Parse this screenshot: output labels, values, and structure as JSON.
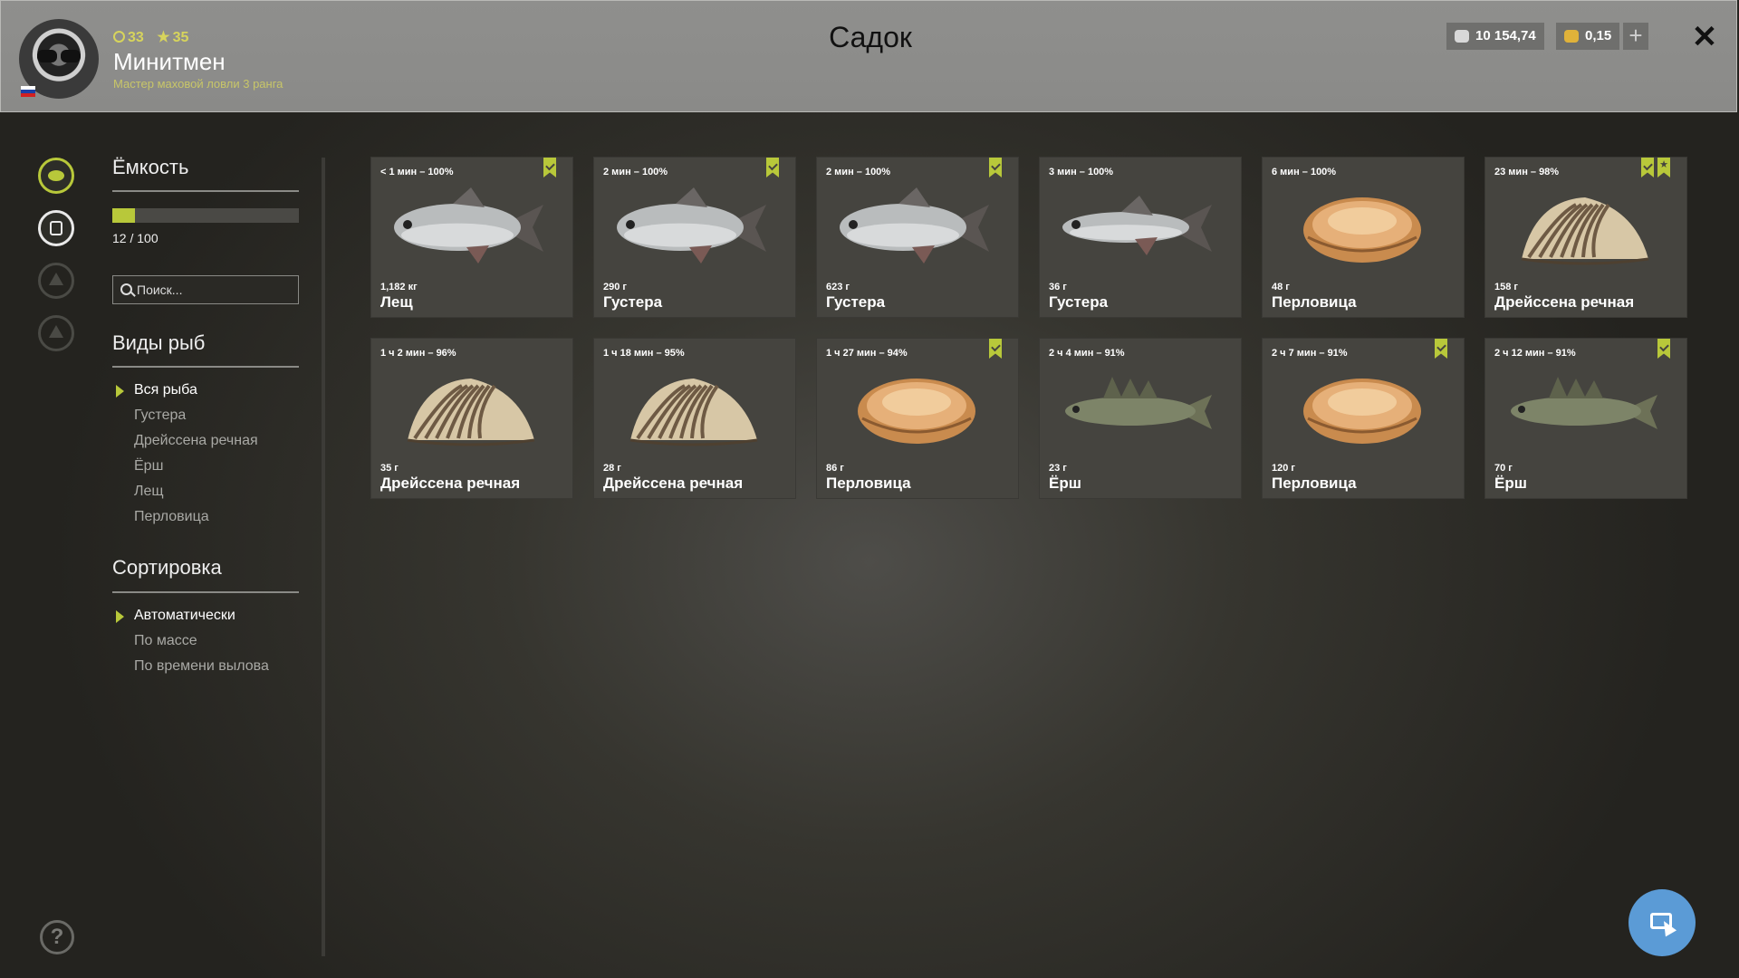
{
  "header": {
    "title": "Садок",
    "player": {
      "name": "Минитмен",
      "rank_title": "Мастер маховой ловли 3 ранга",
      "level": "33",
      "stars": "35",
      "flag_colors": [
        "#ffffff",
        "#1c3fa8",
        "#d22020"
      ]
    },
    "currency": {
      "silver": "10 154,74",
      "gold": "0,15"
    },
    "add_label": "+",
    "close_label": "✕"
  },
  "sidebar_icons": [
    "fish-icon",
    "keepnet-icon",
    "camp-icon",
    "home-icon"
  ],
  "capacity": {
    "title": "Ёмкость",
    "text": "12 / 100",
    "fill_fraction": 0.12
  },
  "search": {
    "placeholder": "Поиск..."
  },
  "species": {
    "title": "Виды рыб",
    "items": [
      {
        "label": "Вся рыба",
        "active": true
      },
      {
        "label": "Густера",
        "active": false
      },
      {
        "label": "Дрейссена речная",
        "active": false
      },
      {
        "label": "Ёрш",
        "active": false
      },
      {
        "label": "Лещ",
        "active": false
      },
      {
        "label": "Перловица",
        "active": false
      }
    ]
  },
  "sorting": {
    "title": "Сортировка",
    "items": [
      {
        "label": "Автоматически",
        "active": true
      },
      {
        "label": "По массе",
        "active": false
      },
      {
        "label": "По времени вылова",
        "active": false
      }
    ]
  },
  "catch": [
    {
      "time": "< 1 мин – 100%",
      "weight": "1,182 кг",
      "name": "Лещ",
      "kind": "bream",
      "marked": true,
      "star": false
    },
    {
      "time": "2 мин – 100%",
      "weight": "290 г",
      "name": "Густера",
      "kind": "bream",
      "marked": true,
      "star": false
    },
    {
      "time": "2 мин – 100%",
      "weight": "623 г",
      "name": "Густера",
      "kind": "bream",
      "marked": true,
      "star": false
    },
    {
      "time": "3 мин – 100%",
      "weight": "36 г",
      "name": "Густера",
      "kind": "slim",
      "marked": false,
      "star": false
    },
    {
      "time": "6 мин – 100%",
      "weight": "48 г",
      "name": "Перловица",
      "kind": "mussel",
      "marked": false,
      "star": false
    },
    {
      "time": "23 мин – 98%",
      "weight": "158 г",
      "name": "Дрейссена речная",
      "kind": "zebra",
      "marked": true,
      "star": true
    },
    {
      "time": "1 ч 2 мин – 96%",
      "weight": "35 г",
      "name": "Дрейссена речная",
      "kind": "zebra",
      "marked": false,
      "star": false
    },
    {
      "time": "1 ч 18 мин – 95%",
      "weight": "28 г",
      "name": "Дрейссена речная",
      "kind": "zebra",
      "marked": false,
      "star": false
    },
    {
      "time": "1 ч 27 мин – 94%",
      "weight": "86 г",
      "name": "Перловица",
      "kind": "mussel",
      "marked": true,
      "star": false
    },
    {
      "time": "2 ч 4 мин – 91%",
      "weight": "23 г",
      "name": "Ёрш",
      "kind": "ruffe",
      "marked": false,
      "star": false
    },
    {
      "time": "2 ч 7 мин – 91%",
      "weight": "120 г",
      "name": "Перловица",
      "kind": "mussel",
      "marked": true,
      "star": false
    },
    {
      "time": "2 ч 12 мин – 91%",
      "weight": "70 г",
      "name": "Ёрш",
      "kind": "ruffe",
      "marked": true,
      "star": false
    }
  ],
  "help_label": "?",
  "colors": {
    "accent": "#b8c83a",
    "card_bg": "#45443f",
    "action_button": "#5b9bd6"
  }
}
